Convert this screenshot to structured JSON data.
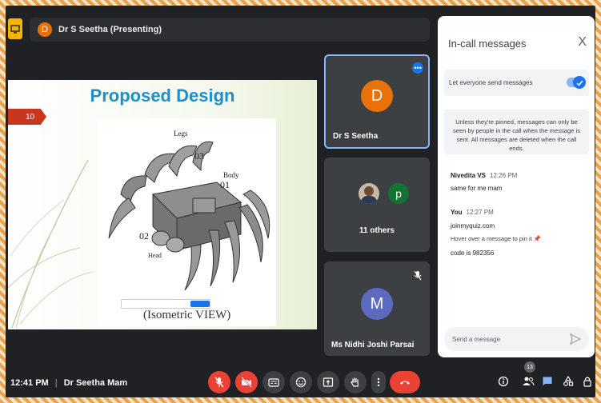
{
  "presenter_bar": {
    "avatar_initial": "D",
    "name": "Dr S Seetha (Presenting)"
  },
  "slide": {
    "title": "Proposed Design",
    "number": "10",
    "labels": {
      "legs": "Legs",
      "body": "Body",
      "head": "Head",
      "n03": "03",
      "n01": "01",
      "n02": "02"
    },
    "caption": "(Isometric VIEW)"
  },
  "tiles": [
    {
      "initial": "D",
      "name": "Dr S Seetha",
      "color": "#e8710a"
    },
    {
      "initial": "p",
      "name": "11 others",
      "color": "#137333"
    },
    {
      "initial": "M",
      "name": "Ms Nidhi Joshi Parsai",
      "color": "#5c6bc0"
    }
  ],
  "panel": {
    "title": "In-call messages",
    "close": "X",
    "toggle_label": "Let everyone send messages",
    "info": "Unless they're pinned, messages can only be seen by people in the call when the message is sent. All messages are deleted when the call ends.",
    "messages": [
      {
        "sender": "Nivedita VS",
        "time": "12:26 PM",
        "lines": [
          "same for me mam"
        ]
      },
      {
        "sender": "You",
        "time": "12:27 PM",
        "lines": [
          "joinmyquiz.com",
          "Hover over a message to pin it 📌",
          "code is 982356"
        ]
      }
    ],
    "input_placeholder": "Send a message"
  },
  "bottom_bar": {
    "time": "12:41 PM",
    "separator": "|",
    "meeting_name": "Dr Seetha Mam",
    "participant_count": "13"
  }
}
